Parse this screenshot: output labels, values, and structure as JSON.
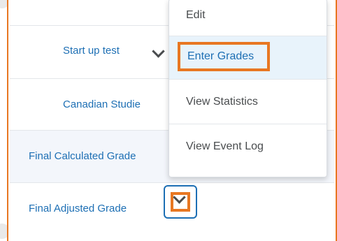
{
  "rows": {
    "start_up_test": "Start up test",
    "canadian_studies": "Canadian Studie",
    "final_calculated_grade": "Final Calculated Grade",
    "final_adjusted_grade": "Final Adjusted Grade"
  },
  "menu": {
    "items": [
      "Edit",
      "Enter Grades",
      "View Statistics",
      "View Event Log"
    ]
  },
  "colors": {
    "link": "#1d6fb4",
    "highlight": "#e87722",
    "menu_text": "#494c4e"
  }
}
